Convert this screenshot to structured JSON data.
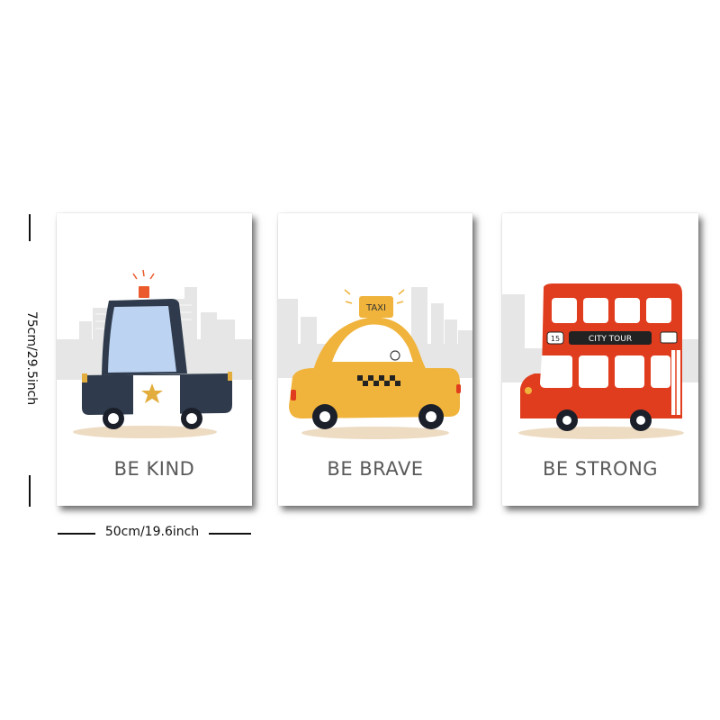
{
  "posters": [
    {
      "caption": "BE KIND",
      "subject": "police-car",
      "color": "#2f3b4c"
    },
    {
      "caption": "BE BRAVE",
      "subject": "taxi",
      "color": "#f0b33b",
      "sign": "TAXI"
    },
    {
      "caption": "BE STRONG",
      "subject": "double-decker-bus",
      "color": "#e03d1e",
      "route_number": "15",
      "route_name": "CITY TOUR"
    }
  ],
  "dimensions": {
    "height_label": "75cm/29.5inch",
    "width_label": "50cm/19.6inch"
  },
  "colors": {
    "skyline": "#e5e5e5",
    "caption_text": "#5a5a5a",
    "police_blue": "#2f3b4c",
    "police_window": "#bcd3f2",
    "taxi_yellow": "#f0b33b",
    "bus_red": "#e03d1e",
    "star": "#e2ad3c",
    "light": "#ea5a2a"
  }
}
